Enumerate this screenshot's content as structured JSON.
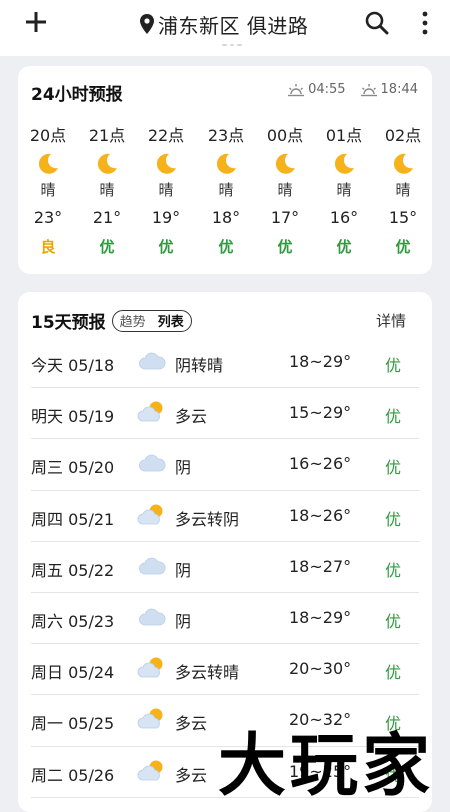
{
  "header": {
    "location": "浦东新区 俱进路"
  },
  "hourly": {
    "title": "24小时预报",
    "sunrise": "04:55",
    "sunset": "18:44",
    "items": [
      {
        "time": "20点",
        "icon": "moon-icon",
        "cond": "晴",
        "temp": "23°",
        "aqi": "良",
        "aqi_color": "#e6a800"
      },
      {
        "time": "21点",
        "icon": "moon-icon",
        "cond": "晴",
        "temp": "21°",
        "aqi": "优",
        "aqi_color": "#2e9b3e"
      },
      {
        "time": "22点",
        "icon": "moon-icon",
        "cond": "晴",
        "temp": "19°",
        "aqi": "优",
        "aqi_color": "#2e9b3e"
      },
      {
        "time": "23点",
        "icon": "moon-icon",
        "cond": "晴",
        "temp": "18°",
        "aqi": "优",
        "aqi_color": "#2e9b3e"
      },
      {
        "time": "00点",
        "icon": "moon-icon",
        "cond": "晴",
        "temp": "17°",
        "aqi": "优",
        "aqi_color": "#2e9b3e"
      },
      {
        "time": "01点",
        "icon": "moon-icon",
        "cond": "晴",
        "temp": "16°",
        "aqi": "优",
        "aqi_color": "#2e9b3e"
      },
      {
        "time": "02点",
        "icon": "moon-icon",
        "cond": "晴",
        "temp": "15°",
        "aqi": "优",
        "aqi_color": "#2e9b3e"
      }
    ]
  },
  "daily": {
    "title": "15天预报",
    "toggle_trend": "趋势",
    "toggle_list": "列表",
    "detail": "详情",
    "items": [
      {
        "day": "今天 05/18",
        "icon": "cloud-icon",
        "cond": "阴转晴",
        "temp": "18~29°",
        "aqi": "优"
      },
      {
        "day": "明天 05/19",
        "icon": "partly-cloudy-icon",
        "cond": "多云",
        "temp": "15~29°",
        "aqi": "优"
      },
      {
        "day": "周三 05/20",
        "icon": "cloud-icon",
        "cond": "阴",
        "temp": "16~26°",
        "aqi": "优"
      },
      {
        "day": "周四 05/21",
        "icon": "partly-cloudy-icon",
        "cond": "多云转阴",
        "temp": "18~26°",
        "aqi": "优"
      },
      {
        "day": "周五 05/22",
        "icon": "cloud-icon",
        "cond": "阴",
        "temp": "18~27°",
        "aqi": "优"
      },
      {
        "day": "周六 05/23",
        "icon": "cloud-icon",
        "cond": "阴",
        "temp": "18~29°",
        "aqi": "优"
      },
      {
        "day": "周日 05/24",
        "icon": "partly-cloudy-icon",
        "cond": "多云转晴",
        "temp": "20~30°",
        "aqi": "优"
      },
      {
        "day": "周一 05/25",
        "icon": "partly-cloudy-icon",
        "cond": "多云",
        "temp": "20~32°",
        "aqi": "优"
      },
      {
        "day": "周二 05/26",
        "icon": "partly-cloudy-icon",
        "cond": "多云",
        "temp": "19~25°",
        "aqi": "优"
      }
    ]
  },
  "watermark": "大玩家"
}
